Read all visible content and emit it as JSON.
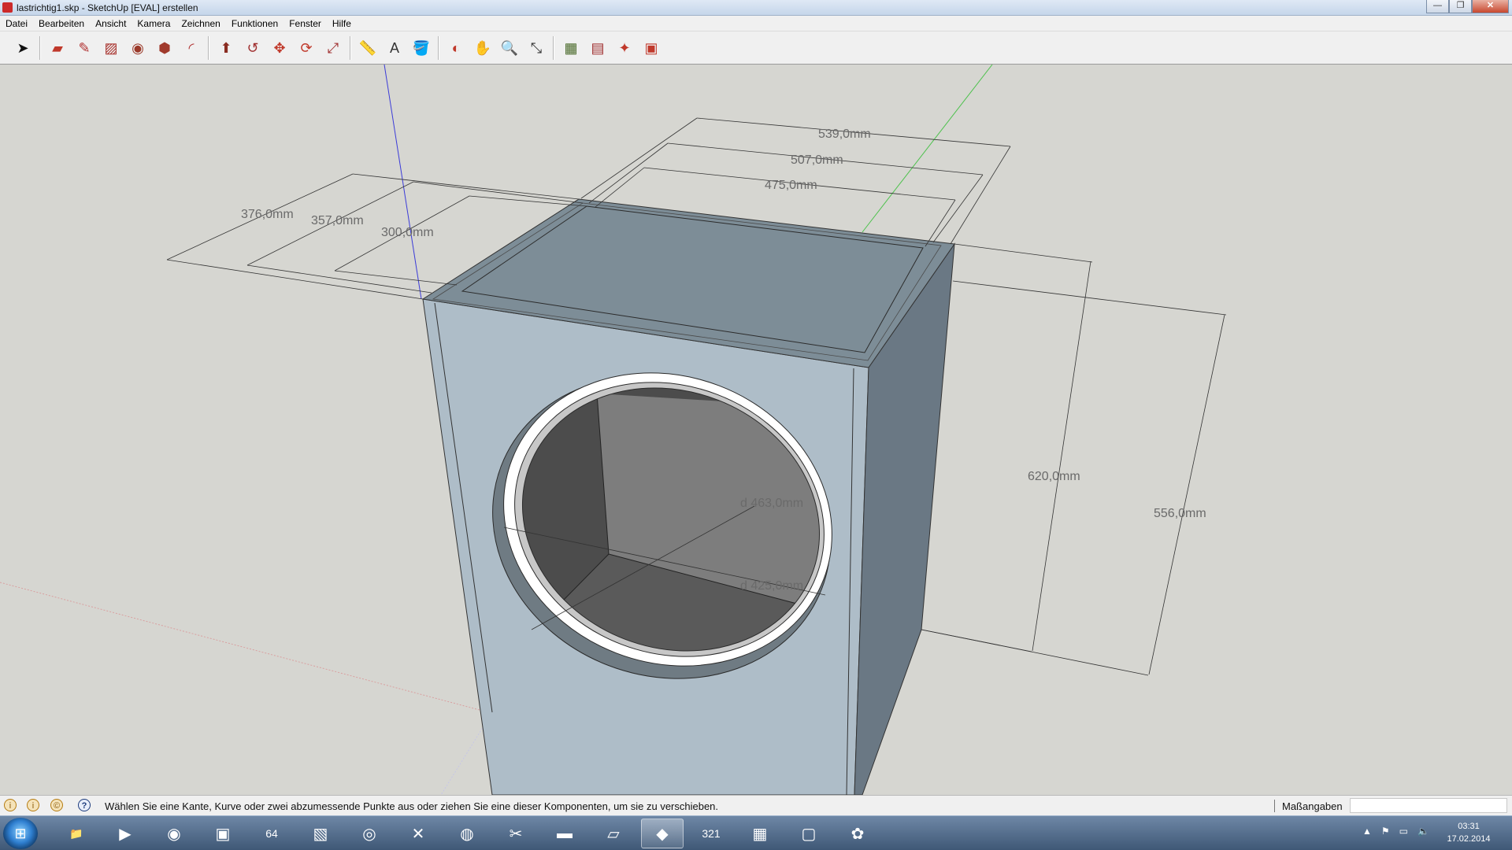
{
  "window": {
    "title": "lastrichtig1.skp - SketchUp [EVAL] erstellen",
    "buttons": {
      "minimize": "—",
      "maximize": "❐",
      "close": "✕"
    }
  },
  "menu": [
    "Datei",
    "Bearbeiten",
    "Ansicht",
    "Kamera",
    "Zeichnen",
    "Funktionen",
    "Fenster",
    "Hilfe"
  ],
  "toolbar": {
    "groups": [
      [
        {
          "name": "select-tool-icon",
          "glyph": "➤",
          "color": "#111111"
        }
      ],
      [
        {
          "name": "eraser-tool-icon",
          "glyph": "▰",
          "color": "#c0392b"
        },
        {
          "name": "pencil-tool-icon",
          "glyph": "✎",
          "color": "#b03030"
        },
        {
          "name": "rectangle-tool-icon",
          "glyph": "▨",
          "color": "#a8322d"
        },
        {
          "name": "circle-tool-icon",
          "glyph": "◉",
          "color": "#9b3a2a"
        },
        {
          "name": "polygon-tool-icon",
          "glyph": "⬢",
          "color": "#a03a2c"
        },
        {
          "name": "arc-tool-icon",
          "glyph": "◜",
          "color": "#b03030"
        }
      ],
      [
        {
          "name": "push-pull-tool-icon",
          "glyph": "⬆",
          "color": "#8a2d22"
        },
        {
          "name": "follow-me-tool-icon",
          "glyph": "↺",
          "color": "#a03030"
        },
        {
          "name": "move-tool-icon",
          "glyph": "✥",
          "color": "#c0392b"
        },
        {
          "name": "rotate-tool-icon",
          "glyph": "⟳",
          "color": "#c0392b"
        },
        {
          "name": "scale-tool-icon",
          "glyph": "⤢",
          "color": "#a03030"
        }
      ],
      [
        {
          "name": "tape-measure-tool-icon",
          "glyph": "📏",
          "color": "#b58b20"
        },
        {
          "name": "text-tool-icon",
          "glyph": "A",
          "color": "#333333"
        },
        {
          "name": "paint-bucket-tool-icon",
          "glyph": "🪣",
          "color": "#b58b20"
        }
      ],
      [
        {
          "name": "orbit-tool-icon",
          "glyph": "◐",
          "color": "#c0392b"
        },
        {
          "name": "pan-tool-icon",
          "glyph": "✋",
          "color": "#444444"
        },
        {
          "name": "zoom-tool-icon",
          "glyph": "🔍",
          "color": "#333333"
        },
        {
          "name": "zoom-extents-tool-icon",
          "glyph": "⤡",
          "color": "#333333"
        }
      ],
      [
        {
          "name": "warehouse-icon",
          "glyph": "▦",
          "color": "#4a6a2a"
        },
        {
          "name": "share-model-icon",
          "glyph": "▤",
          "color": "#a03030"
        },
        {
          "name": "extension-warehouse-icon",
          "glyph": "✦",
          "color": "#c0392b"
        },
        {
          "name": "send-to-layout-icon",
          "glyph": "▣",
          "color": "#c0392b"
        }
      ]
    ]
  },
  "dimensions": {
    "width_outer": "539,0mm",
    "width_mid": "507,0mm",
    "width_inner": "475,0mm",
    "depth_outer": "376,0mm",
    "depth_mid": "357,0mm",
    "depth_inner": "300,0mm",
    "height_outer": "620,0mm",
    "height_inner": "556,0mm",
    "diameter_outer": "d 463,0mm",
    "diameter_inner": "d 425,0mm"
  },
  "status": {
    "hint": "Wählen Sie eine Kante, Kurve oder zwei abzumessende Punkte aus oder ziehen Sie eine dieser Komponenten, um sie zu verschieben.",
    "measure_label": "Maßangaben",
    "measure_value": "",
    "icons": [
      "i",
      "i",
      "©",
      "?"
    ]
  },
  "taskbar": {
    "items": [
      {
        "name": "explorer-icon",
        "glyph": "📁",
        "active": false
      },
      {
        "name": "media-player-icon",
        "glyph": "▶",
        "active": false
      },
      {
        "name": "firefox-icon",
        "glyph": "◉",
        "active": false
      },
      {
        "name": "visual-studio-icon",
        "glyph": "▣",
        "active": false
      },
      {
        "name": "app-64-icon",
        "glyph": "64",
        "active": false
      },
      {
        "name": "photos-icon",
        "glyph": "▧",
        "active": false
      },
      {
        "name": "chrome-icon",
        "glyph": "◎",
        "active": false
      },
      {
        "name": "excel-icon",
        "glyph": "✕",
        "active": false
      },
      {
        "name": "globe-icon",
        "glyph": "◍",
        "active": false
      },
      {
        "name": "tools-icon",
        "glyph": "✂",
        "active": false
      },
      {
        "name": "terminal-icon",
        "glyph": "▬",
        "active": false
      },
      {
        "name": "notepad-icon",
        "glyph": "▱",
        "active": false
      },
      {
        "name": "sketchup-icon",
        "glyph": "◆",
        "active": true
      },
      {
        "name": "media-321-icon",
        "glyph": "321",
        "active": false
      },
      {
        "name": "calculator-icon",
        "glyph": "▦",
        "active": false
      },
      {
        "name": "screenshot-icon",
        "glyph": "▢",
        "active": false
      },
      {
        "name": "paint-icon",
        "glyph": "✿",
        "active": false
      }
    ],
    "tray": [
      "▲",
      "⚑",
      "▭",
      "🔈"
    ],
    "clock_time": "03:31",
    "clock_date": "17.02.2014"
  }
}
